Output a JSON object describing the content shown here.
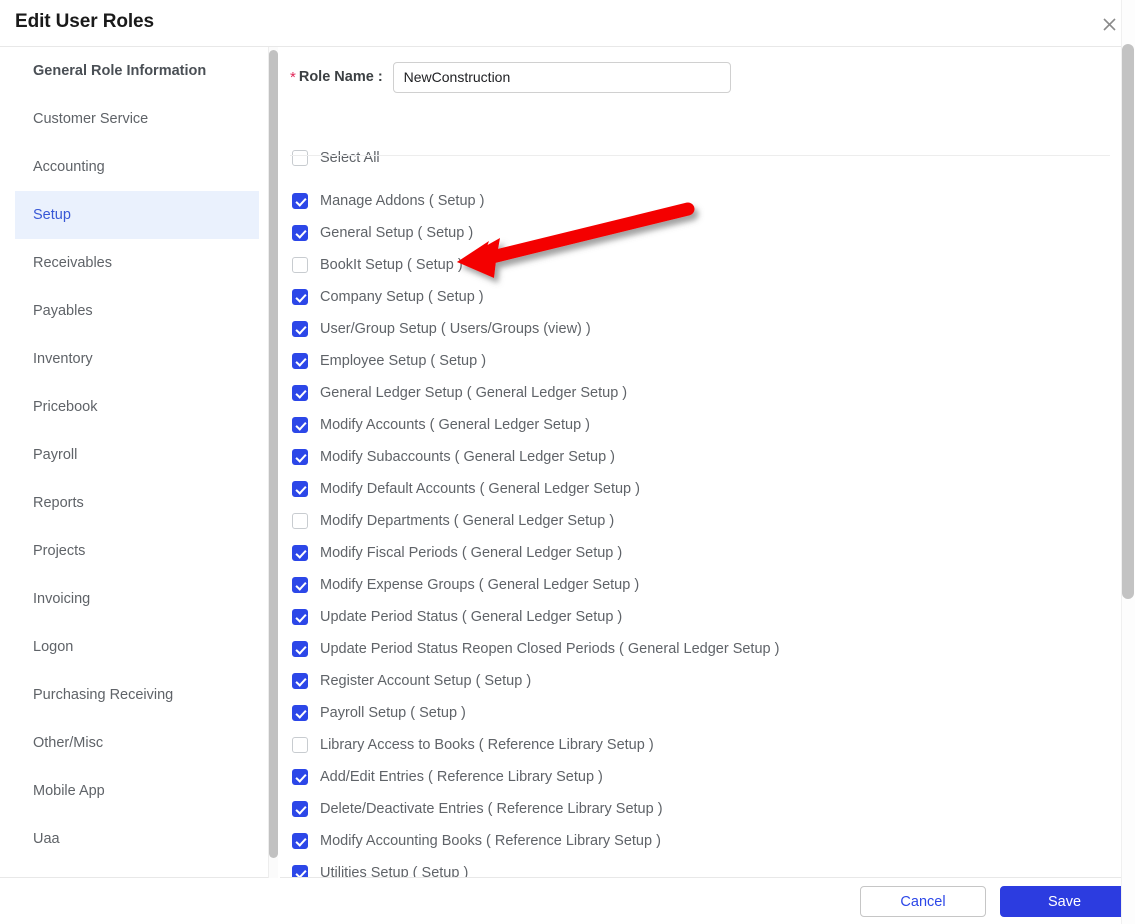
{
  "dialog": {
    "title": "Edit User Roles",
    "close_icon": "close-icon"
  },
  "sidebar": {
    "items": [
      {
        "label": "General Role Information",
        "active": false,
        "bold": true
      },
      {
        "label": "Customer Service",
        "active": false,
        "bold": false
      },
      {
        "label": "Accounting",
        "active": false,
        "bold": false
      },
      {
        "label": "Setup",
        "active": true,
        "bold": false
      },
      {
        "label": "Receivables",
        "active": false,
        "bold": false
      },
      {
        "label": "Payables",
        "active": false,
        "bold": false
      },
      {
        "label": "Inventory",
        "active": false,
        "bold": false
      },
      {
        "label": "Pricebook",
        "active": false,
        "bold": false
      },
      {
        "label": "Payroll",
        "active": false,
        "bold": false
      },
      {
        "label": "Reports",
        "active": false,
        "bold": false
      },
      {
        "label": "Projects",
        "active": false,
        "bold": false
      },
      {
        "label": "Invoicing",
        "active": false,
        "bold": false
      },
      {
        "label": "Logon",
        "active": false,
        "bold": false
      },
      {
        "label": "Purchasing Receiving",
        "active": false,
        "bold": false
      },
      {
        "label": "Other/Misc",
        "active": false,
        "bold": false
      },
      {
        "label": "Mobile App",
        "active": false,
        "bold": false
      },
      {
        "label": "Uaa",
        "active": false,
        "bold": false
      }
    ]
  },
  "form": {
    "required_marker": "*",
    "rolename_label": "Role Name :",
    "rolename_value": "NewConstruction",
    "rolename_placeholder": "",
    "select_all_label": "Select All",
    "select_all_checked": false
  },
  "permissions": [
    {
      "label": "Manage Addons ( Setup )",
      "checked": true
    },
    {
      "label": "General Setup ( Setup )",
      "checked": true
    },
    {
      "label": "BookIt Setup ( Setup )",
      "checked": false
    },
    {
      "label": "Company Setup ( Setup )",
      "checked": true
    },
    {
      "label": "User/Group Setup ( Users/Groups (view) )",
      "checked": true
    },
    {
      "label": "Employee Setup ( Setup )",
      "checked": true
    },
    {
      "label": "General Ledger Setup ( General Ledger Setup )",
      "checked": true
    },
    {
      "label": "Modify Accounts ( General Ledger Setup )",
      "checked": true
    },
    {
      "label": "Modify Subaccounts ( General Ledger Setup )",
      "checked": true
    },
    {
      "label": "Modify Default Accounts ( General Ledger Setup )",
      "checked": true
    },
    {
      "label": "Modify Departments ( General Ledger Setup )",
      "checked": false
    },
    {
      "label": "Modify Fiscal Periods ( General Ledger Setup )",
      "checked": true
    },
    {
      "label": "Modify Expense Groups ( General Ledger Setup )",
      "checked": true
    },
    {
      "label": "Update Period Status ( General Ledger Setup )",
      "checked": true
    },
    {
      "label": "Update Period Status Reopen Closed Periods ( General Ledger Setup )",
      "checked": true
    },
    {
      "label": "Register Account Setup ( Setup )",
      "checked": true
    },
    {
      "label": "Payroll Setup ( Setup )",
      "checked": true
    },
    {
      "label": "Library Access to Books ( Reference Library Setup )",
      "checked": false
    },
    {
      "label": "Add/Edit Entries ( Reference Library Setup )",
      "checked": true
    },
    {
      "label": "Delete/Deactivate Entries ( Reference Library Setup )",
      "checked": true
    },
    {
      "label": "Modify Accounting Books ( Reference Library Setup )",
      "checked": true
    },
    {
      "label": "Utilities Setup ( Setup )",
      "checked": true
    }
  ],
  "footer": {
    "cancel_label": "Cancel",
    "save_label": "Save"
  },
  "annotation": {
    "type": "arrow",
    "color": "#f40000",
    "points_at": "BookIt Setup ( Setup )"
  },
  "colors": {
    "accent": "#2c47e8",
    "save_button": "#2c3ce0",
    "active_nav_bg": "#eaf1fd",
    "active_nav_text": "#3858d6",
    "required_star": "#e0295a",
    "body_text": "#5f6368",
    "annotation_red": "#f40000"
  }
}
